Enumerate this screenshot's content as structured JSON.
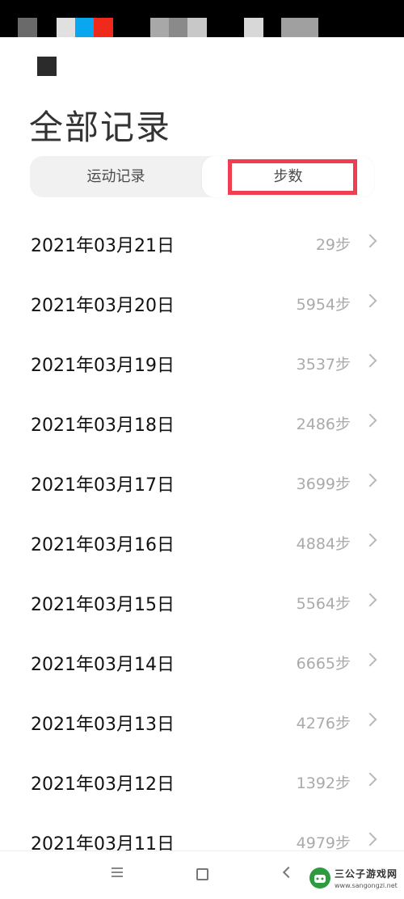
{
  "header": {
    "back_icon": "back-icon",
    "title": "全部记录"
  },
  "tabs": [
    {
      "label": "运动记录",
      "selected": false
    },
    {
      "label": "步数",
      "selected": true
    }
  ],
  "records": [
    {
      "date": "2021年03月21日",
      "steps": "29步"
    },
    {
      "date": "2021年03月20日",
      "steps": "5954步"
    },
    {
      "date": "2021年03月19日",
      "steps": "3537步"
    },
    {
      "date": "2021年03月18日",
      "steps": "2486步"
    },
    {
      "date": "2021年03月17日",
      "steps": "3699步"
    },
    {
      "date": "2021年03月16日",
      "steps": "4884步"
    },
    {
      "date": "2021年03月15日",
      "steps": "5564步"
    },
    {
      "date": "2021年03月14日",
      "steps": "6665步"
    },
    {
      "date": "2021年03月13日",
      "steps": "4276步"
    },
    {
      "date": "2021年03月12日",
      "steps": "1392步"
    },
    {
      "date": "2021年03月11日",
      "steps": "4979步"
    }
  ],
  "navbar": {
    "menu_icon": "menu-icon",
    "home_icon": "home-icon",
    "back_icon": "back-arrow-icon"
  },
  "watermark": {
    "name": "三公子游戏网",
    "url": "www.sangongzi.net"
  },
  "colors": {
    "highlight": "#ef3e4f",
    "step_text": "#aaaaaa"
  }
}
